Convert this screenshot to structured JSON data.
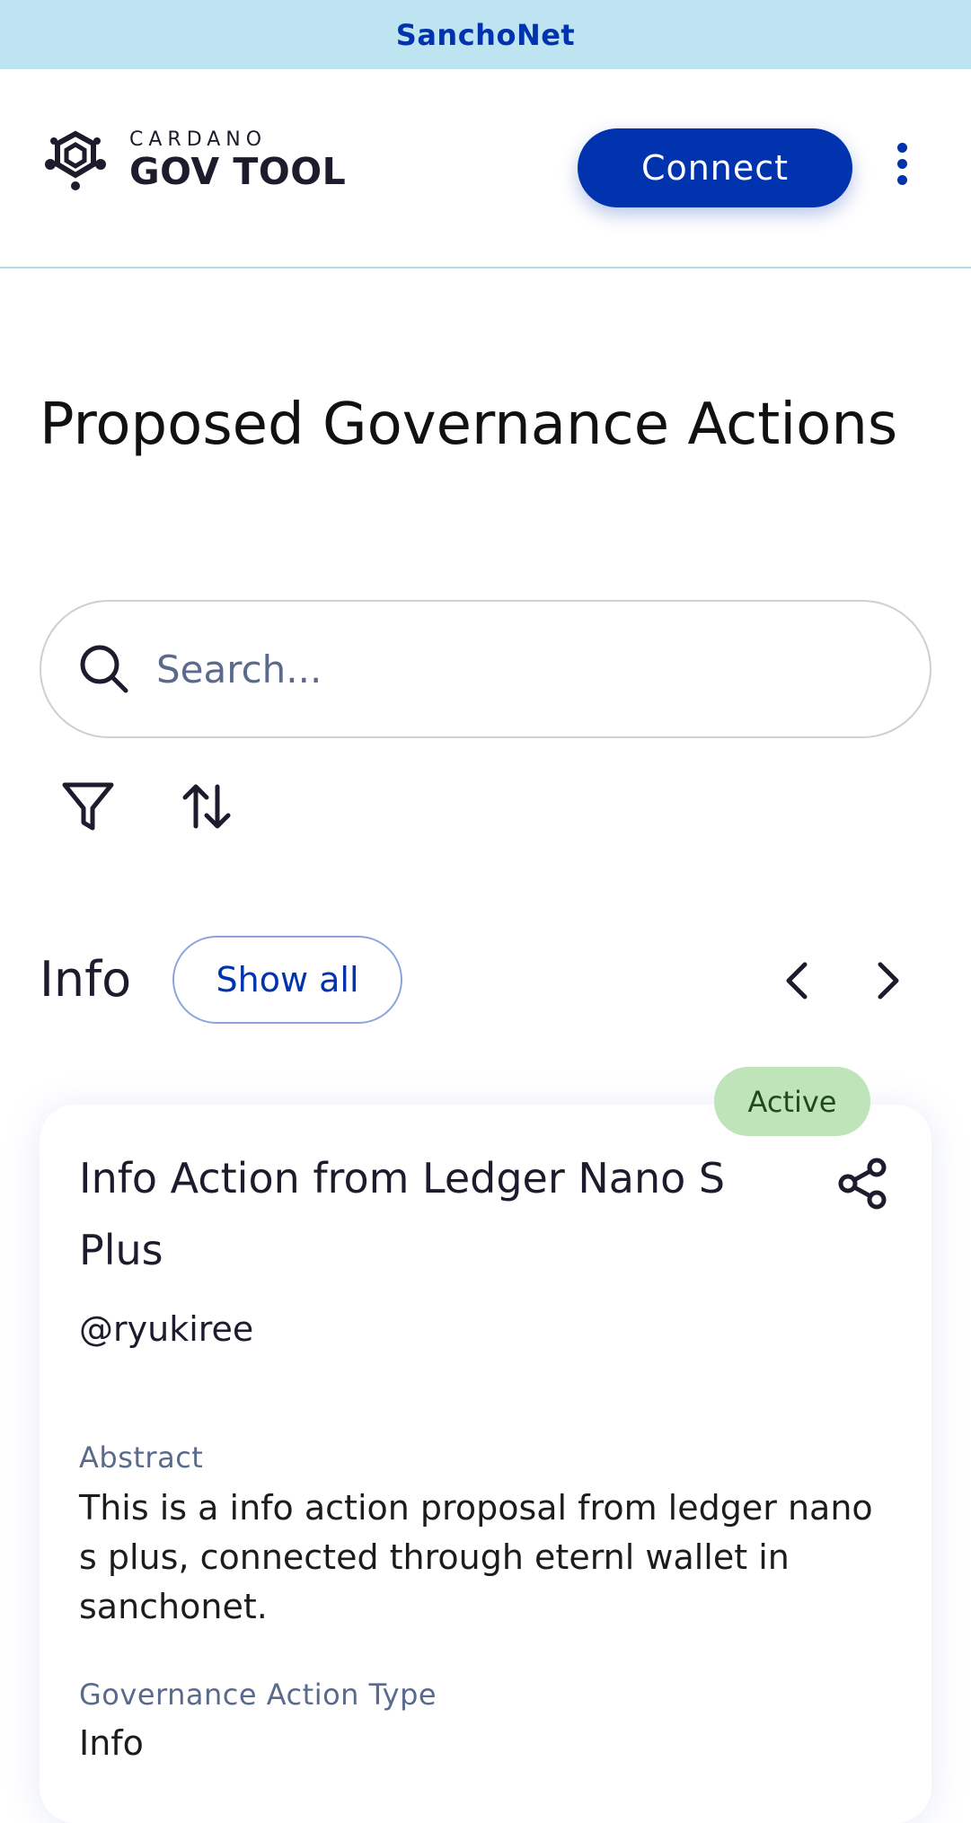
{
  "banner": {
    "network": "SanchoNet"
  },
  "header": {
    "logo_small": "CARDANO",
    "logo_big": "GOV TOOL",
    "connect_label": "Connect",
    "colors": {
      "brand": "#0033ad",
      "banner_bg": "#bde4f0"
    }
  },
  "page": {
    "title": "Proposed Governance Actions"
  },
  "search": {
    "placeholder": "Search..."
  },
  "toolbar": {
    "filter_icon": "filter-icon",
    "sort_icon": "sort-icon"
  },
  "section": {
    "title": "Info",
    "show_all_label": "Show all",
    "prev_icon": "chevron-left-icon",
    "next_icon": "chevron-right-icon"
  },
  "card": {
    "status": "Active",
    "status_color": "#c0e4b9",
    "title": "Info Action from Ledger Nano S Plus",
    "author": "@ryukiree",
    "abstract_label": "Abstract",
    "abstract": "This is a info action proposal from ledger nano s plus, connected through eternl wallet in sanchonet.",
    "type_label": "Governance Action Type",
    "type_value": "Info"
  }
}
